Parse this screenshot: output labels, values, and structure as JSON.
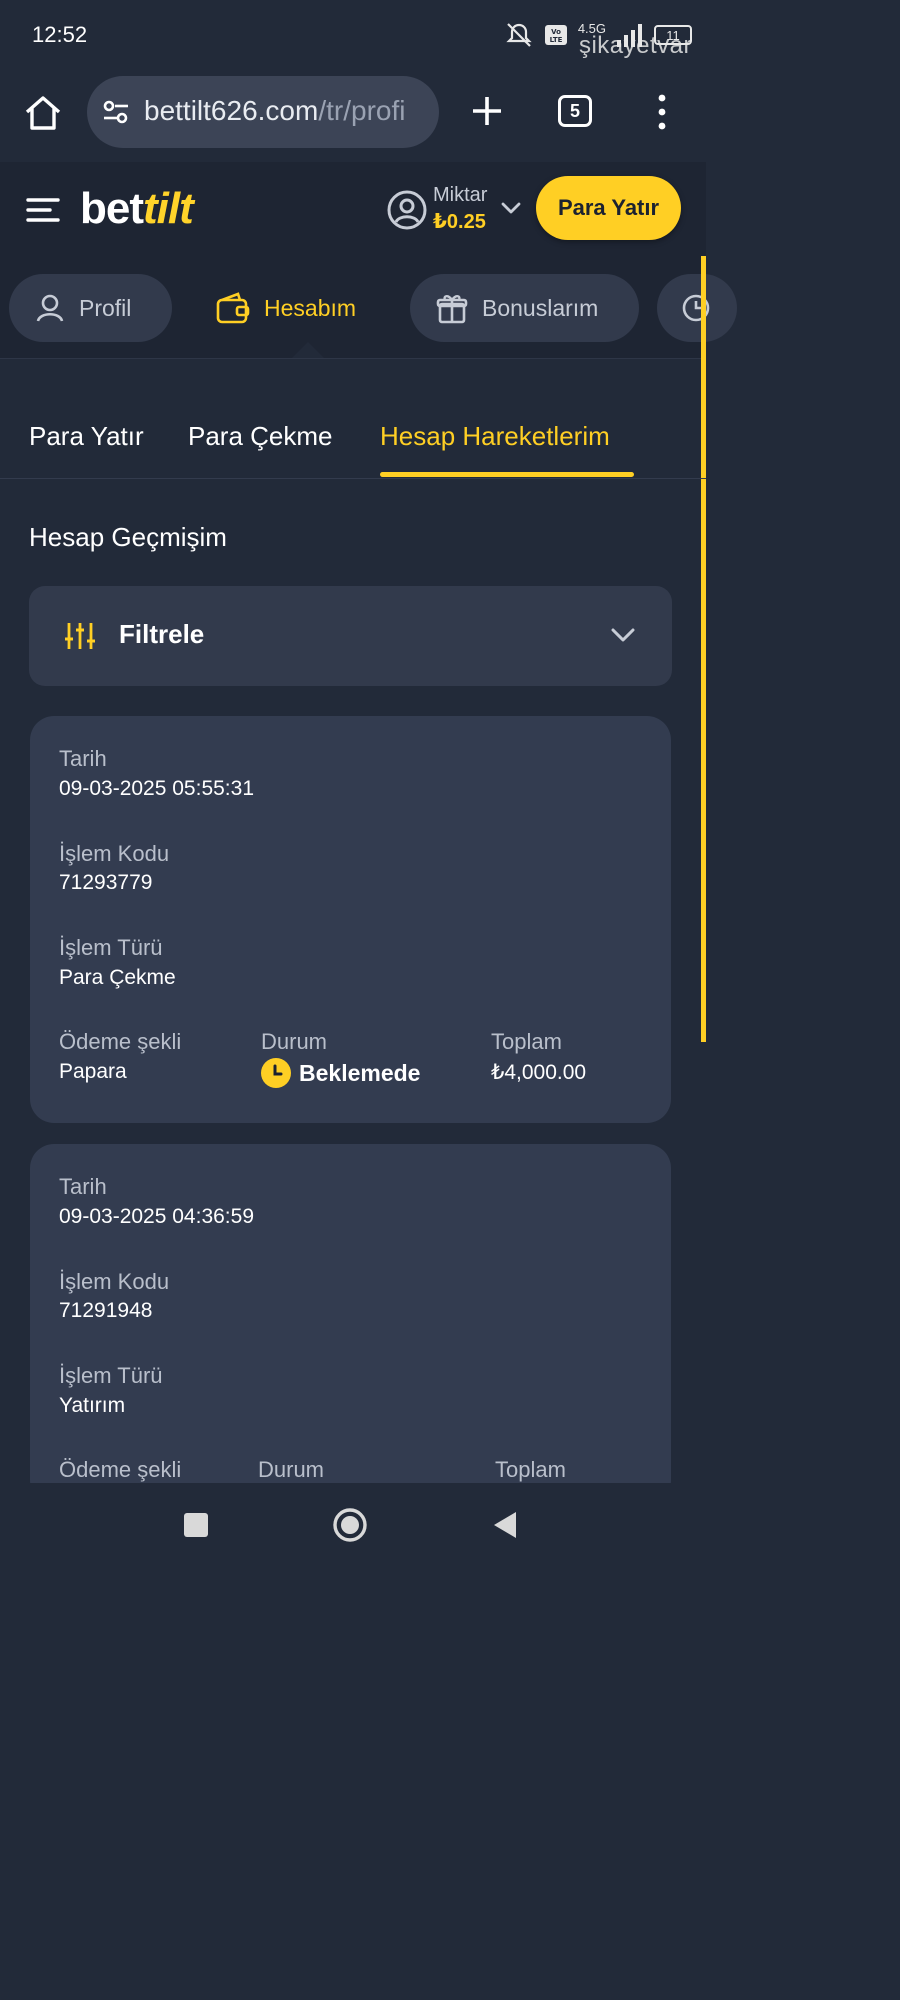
{
  "status_bar": {
    "time": "12:52",
    "network": "4.5G",
    "battery": "11",
    "watermark": "şikayetvar",
    "icons": [
      "mute-icon",
      "volte-icon",
      "signal-icon",
      "battery-icon"
    ]
  },
  "browser": {
    "url_main": "bettilt626.com",
    "url_rest": "/tr/profi",
    "tab_count": "5"
  },
  "header": {
    "logo_main": "bet",
    "logo_accent": "tilt",
    "balance_label": "Miktar",
    "balance_value": "₺0.25",
    "deposit_button": "Para Yatır"
  },
  "profile_tabs": [
    {
      "label": "Profil",
      "icon": "user-icon"
    },
    {
      "label": "Hesabım",
      "icon": "wallet-icon",
      "active": true
    },
    {
      "label": "Bonuslarım",
      "icon": "gift-icon"
    }
  ],
  "sub_tabs": [
    {
      "label": "Para Yatır"
    },
    {
      "label": "Para Çekme"
    },
    {
      "label": "Hesap Hareketlerim",
      "active": true
    }
  ],
  "section_title": "Hesap Geçmişim",
  "filter": {
    "label": "Filtrele"
  },
  "labels": {
    "date": "Tarih",
    "code": "İşlem Kodu",
    "type": "İşlem Türü",
    "payment": "Ödeme şekli",
    "status": "Durum",
    "total": "Toplam"
  },
  "transactions": [
    {
      "date": "09-03-2025 05:55:31",
      "code": "71293779",
      "type": "Para Çekme",
      "payment": "Papara",
      "status": "Beklemede",
      "total": "₺4,000.00"
    },
    {
      "date": "09-03-2025 04:36:59",
      "code": "71291948",
      "type": "Yatırım"
    }
  ],
  "colors": {
    "background": "#222a39",
    "card": "#333c50",
    "accent": "#ffcf24"
  }
}
